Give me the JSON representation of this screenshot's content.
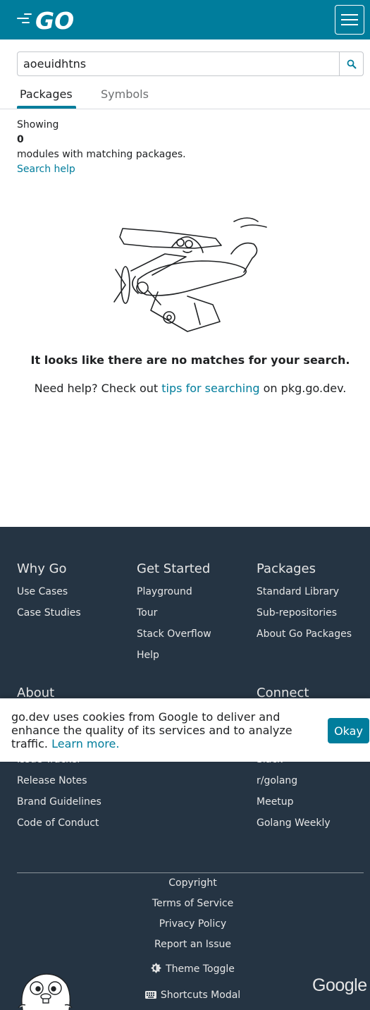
{
  "header": {
    "logo_text": "GO",
    "menu_icon": "hamburger-menu-icon"
  },
  "search": {
    "value": "aoeuidhtns",
    "button_icon": "search-icon"
  },
  "tabs": [
    {
      "label": "Packages",
      "active": true
    },
    {
      "label": "Symbols",
      "active": false
    }
  ],
  "results": {
    "showing_label": "Showing",
    "count": "0",
    "count_suffix": "modules with matching packages.",
    "search_help": "Search help"
  },
  "empty_state": {
    "title": "It looks like there are no matches for your search.",
    "help_prefix": "Need help? Check out",
    "help_link": "tips for searching",
    "help_suffix": "on pkg.go.dev."
  },
  "footer": {
    "why_go": {
      "heading": "Why Go",
      "links": [
        "Use Cases",
        "Case Studies"
      ]
    },
    "get_started": {
      "heading": "Get Started",
      "links": [
        "Playground",
        "Tour",
        "Stack Overflow",
        "Help"
      ]
    },
    "packages": {
      "heading": "Packages",
      "links": [
        "Standard Library",
        "Sub-repositories",
        "About Go Packages"
      ]
    },
    "about": {
      "heading": "About",
      "links": [
        "Issue Tracker",
        "Release Notes",
        "Brand Guidelines",
        "Code of Conduct"
      ]
    },
    "connect": {
      "heading": "Connect",
      "links": [
        "Slack",
        "r/golang",
        "Meetup",
        "Golang Weekly"
      ]
    },
    "legal": [
      "Copyright",
      "Terms of Service",
      "Privacy Policy",
      "Report an Issue"
    ],
    "theme_toggle": "Theme Toggle",
    "shortcuts_modal": "Shortcuts Modal",
    "google_logo": "Google"
  },
  "cookie_banner": {
    "text": "go.dev uses cookies from Google to deliver and enhance the quality of its services and to analyze traffic.",
    "learn_more": "Learn more.",
    "okay": "Okay"
  },
  "colors": {
    "brand": "#007d9c",
    "footer_bg": "#253443",
    "footer_text": "#e6e6e6"
  }
}
